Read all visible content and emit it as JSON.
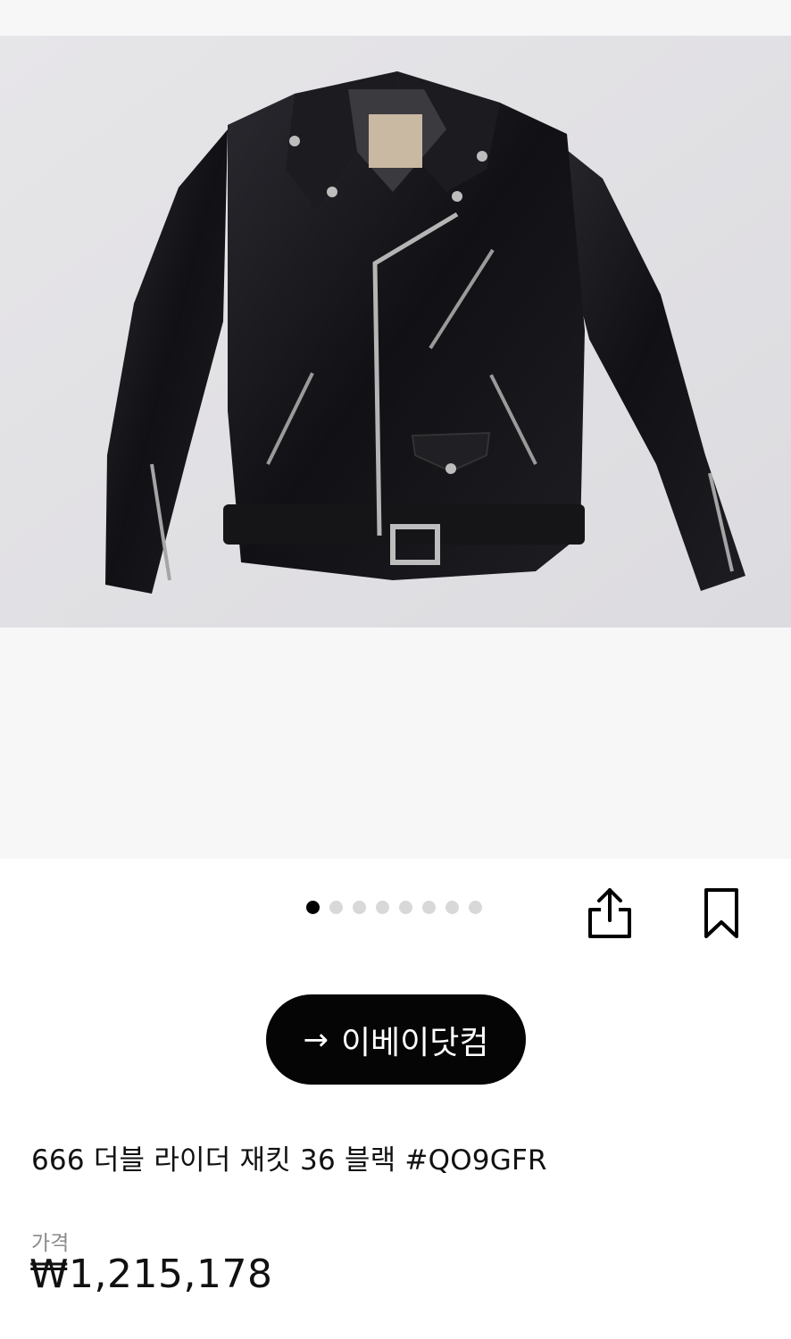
{
  "gallery": {
    "total_images": 8,
    "active_index": 0
  },
  "actions": {
    "share_icon": "share-icon",
    "bookmark_icon": "bookmark-icon"
  },
  "cta": {
    "arrow": "→",
    "label": "이베이닷컴"
  },
  "product": {
    "title": "666 더블 라이더 재킷 36 블랙 #QO9GFR",
    "price_label": "가격",
    "price": "₩1,215,178"
  },
  "colors": {
    "cta_background": "#050505",
    "dot_active": "#000000",
    "dot_inactive": "#d8d8d8"
  }
}
